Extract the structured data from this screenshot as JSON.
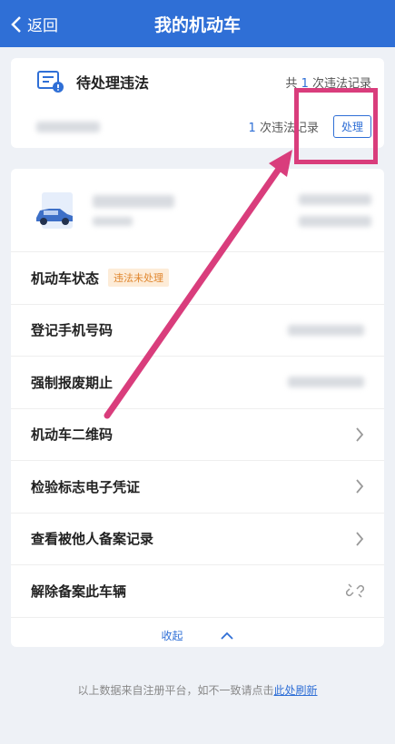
{
  "header": {
    "back_label": "返回",
    "title": "我的机动车"
  },
  "violation": {
    "title": "待处理违法",
    "total_prefix": "共",
    "total_count": "1",
    "total_suffix": "次违法记录",
    "row_count": "1",
    "row_suffix": "次违法记录",
    "handle_label": "处理"
  },
  "vehicle": {
    "status_label": "机动车状态",
    "status_badge": "违法未处理",
    "rows": [
      {
        "label": "登记手机号码"
      },
      {
        "label": "强制报废期止"
      },
      {
        "label": "机动车二维码"
      },
      {
        "label": "检验标志电子凭证"
      },
      {
        "label": "查看被他人备案记录"
      },
      {
        "label": "解除备案此车辆"
      }
    ],
    "collapse_label": "收起"
  },
  "footer": {
    "text": "以上数据来自注册平台，如不一致请点击",
    "link": "此处刷新"
  },
  "colors": {
    "primary": "#2f6fd6",
    "annotation": "#d93d7c",
    "badge_text": "#e0862e"
  }
}
